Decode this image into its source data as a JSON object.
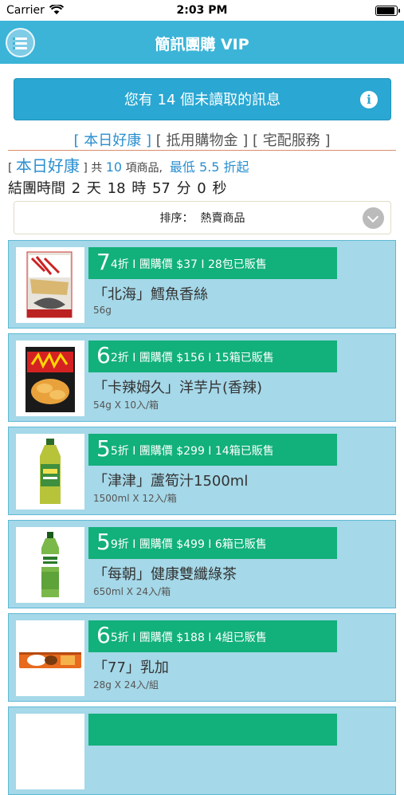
{
  "status_bar": {
    "carrier": "Carrier",
    "time": "2:03 PM"
  },
  "nav": {
    "title": "簡訊團購 VIP"
  },
  "unread_banner": {
    "text": "您有 14 個未讀取的訊息",
    "info_glyph": "i"
  },
  "tabs": [
    {
      "label": "[ 本日好康 ]",
      "active": true
    },
    {
      "label": "[ 抵用購物金 ]",
      "active": false
    },
    {
      "label": "[ 宅配服務 ]",
      "active": false
    }
  ],
  "summary": {
    "bracket_open": "[",
    "section": "本日好康",
    "bracket_close": "]",
    "prefix": "共",
    "count": "10",
    "suffix": "項商品,",
    "min_discount": "最低 5.5 折起"
  },
  "timer": {
    "text": "結團時間 2 天 18 時 57 分 0 秒"
  },
  "sort": {
    "label": "排序：",
    "value": "熱賣商品"
  },
  "products": [
    {
      "discount_big": "7",
      "discount_small": "4",
      "discount_unit": "折",
      "detail": "I 團購價 $37 I 28包已販售",
      "name": "「北海」鱈魚香絲",
      "spec": "56g"
    },
    {
      "discount_big": "6",
      "discount_small": "2",
      "discount_unit": "折",
      "detail": "I 團購價 $156 I 15箱已販售",
      "name": "「卡辣姆久」洋芋片(香辣)",
      "spec": "54g X 10入/箱"
    },
    {
      "discount_big": "5",
      "discount_small": "5",
      "discount_unit": "折",
      "detail": "I 團購價 $299 I 14箱已販售",
      "name": "「津津」蘆筍汁1500ml",
      "spec": "1500ml X 12入/箱"
    },
    {
      "discount_big": "5",
      "discount_small": "9",
      "discount_unit": "折",
      "detail": "I 團購價 $499 I 6箱已販售",
      "name": "「每朝」健康雙纖綠茶",
      "spec": "650ml X 24入/箱"
    },
    {
      "discount_big": "6",
      "discount_small": "5",
      "discount_unit": "折",
      "detail": "I 團購價 $188 I 4組已販售",
      "name": "「77」乳加",
      "spec": "28g X 24入/組"
    }
  ],
  "icons": {
    "menu": "menu-icon",
    "info": "info-icon",
    "chevron": "chevron-down-icon",
    "wifi": "wifi-icon",
    "battery": "battery-icon"
  },
  "colors": {
    "nav": "#3bb4d8",
    "banner": "#2aa7d2",
    "price_bar": "#12b07a",
    "card": "#a5d8e8",
    "accent": "#2a8fd0"
  }
}
